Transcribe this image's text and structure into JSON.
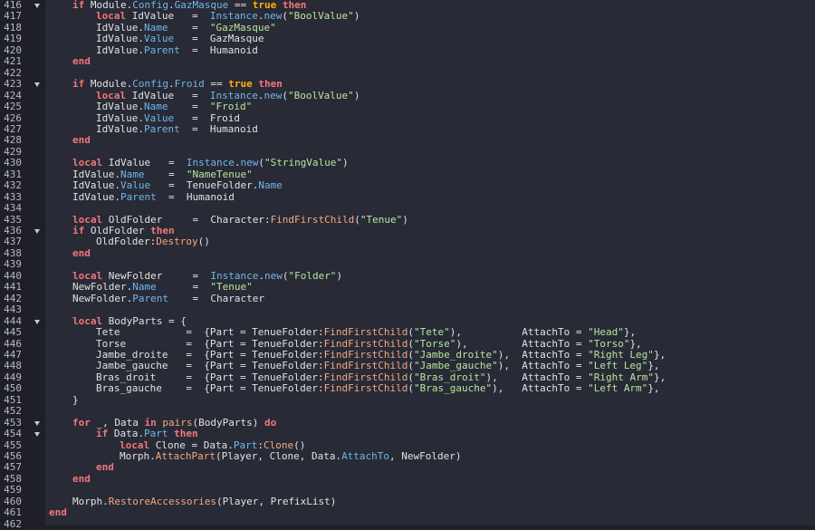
{
  "editor": {
    "lines": [
      {
        "n": "416",
        "fold": true,
        "indent": 1,
        "tokens": [
          [
            "if",
            "k"
          ],
          [
            " Module.",
            "o"
          ],
          [
            "Config",
            "p"
          ],
          [
            ".",
            "o"
          ],
          [
            "GazMasque",
            "p"
          ],
          [
            " == ",
            "o"
          ],
          [
            "true",
            "t"
          ],
          [
            " ",
            "o"
          ],
          [
            "then",
            "k"
          ]
        ]
      },
      {
        "n": "417",
        "fold": false,
        "indent": 2,
        "tokens": [
          [
            "local",
            "k"
          ],
          [
            " IdValue   =  ",
            "o"
          ],
          [
            "Instance",
            "p"
          ],
          [
            ".",
            "o"
          ],
          [
            "new",
            "p"
          ],
          [
            "(",
            "o"
          ],
          [
            "\"BoolValue\"",
            "s"
          ],
          [
            ")",
            "o"
          ]
        ]
      },
      {
        "n": "418",
        "fold": false,
        "indent": 2,
        "tokens": [
          [
            "IdValue.",
            "o"
          ],
          [
            "Name",
            "p"
          ],
          [
            "    =  ",
            "o"
          ],
          [
            "\"GazMasque\"",
            "s"
          ]
        ]
      },
      {
        "n": "419",
        "fold": false,
        "indent": 2,
        "tokens": [
          [
            "IdValue.",
            "o"
          ],
          [
            "Value",
            "p"
          ],
          [
            "   =  GazMasque",
            "o"
          ]
        ]
      },
      {
        "n": "420",
        "fold": false,
        "indent": 2,
        "tokens": [
          [
            "IdValue.",
            "o"
          ],
          [
            "Parent",
            "p"
          ],
          [
            "  =  Humanoid",
            "o"
          ]
        ]
      },
      {
        "n": "421",
        "fold": false,
        "indent": 1,
        "tokens": [
          [
            "end",
            "k"
          ]
        ]
      },
      {
        "n": "422",
        "fold": false,
        "indent": 0,
        "tokens": []
      },
      {
        "n": "423",
        "fold": true,
        "indent": 1,
        "tokens": [
          [
            "if",
            "k"
          ],
          [
            " Module.",
            "o"
          ],
          [
            "Config",
            "p"
          ],
          [
            ".",
            "o"
          ],
          [
            "Froid",
            "p"
          ],
          [
            " == ",
            "o"
          ],
          [
            "true",
            "t"
          ],
          [
            " ",
            "o"
          ],
          [
            "then",
            "k"
          ]
        ]
      },
      {
        "n": "424",
        "fold": false,
        "indent": 2,
        "tokens": [
          [
            "local",
            "k"
          ],
          [
            " IdValue   =  ",
            "o"
          ],
          [
            "Instance",
            "p"
          ],
          [
            ".",
            "o"
          ],
          [
            "new",
            "p"
          ],
          [
            "(",
            "o"
          ],
          [
            "\"BoolValue\"",
            "s"
          ],
          [
            ")",
            "o"
          ]
        ]
      },
      {
        "n": "425",
        "fold": false,
        "indent": 2,
        "tokens": [
          [
            "IdValue.",
            "o"
          ],
          [
            "Name",
            "p"
          ],
          [
            "    =  ",
            "o"
          ],
          [
            "\"Froid\"",
            "s"
          ]
        ]
      },
      {
        "n": "426",
        "fold": false,
        "indent": 2,
        "tokens": [
          [
            "IdValue.",
            "o"
          ],
          [
            "Value",
            "p"
          ],
          [
            "   =  Froid",
            "o"
          ]
        ]
      },
      {
        "n": "427",
        "fold": false,
        "indent": 2,
        "tokens": [
          [
            "IdValue.",
            "o"
          ],
          [
            "Parent",
            "p"
          ],
          [
            "  =  Humanoid",
            "o"
          ]
        ]
      },
      {
        "n": "428",
        "fold": false,
        "indent": 1,
        "tokens": [
          [
            "end",
            "k"
          ]
        ]
      },
      {
        "n": "429",
        "fold": false,
        "indent": 0,
        "tokens": []
      },
      {
        "n": "430",
        "fold": false,
        "indent": 1,
        "tokens": [
          [
            "local",
            "k"
          ],
          [
            " IdValue   =  ",
            "o"
          ],
          [
            "Instance",
            "p"
          ],
          [
            ".",
            "o"
          ],
          [
            "new",
            "p"
          ],
          [
            "(",
            "o"
          ],
          [
            "\"StringValue\"",
            "s"
          ],
          [
            ")",
            "o"
          ]
        ]
      },
      {
        "n": "431",
        "fold": false,
        "indent": 1,
        "tokens": [
          [
            "IdValue.",
            "o"
          ],
          [
            "Name",
            "p"
          ],
          [
            "    =  ",
            "o"
          ],
          [
            "\"NameTenue\"",
            "s"
          ]
        ]
      },
      {
        "n": "432",
        "fold": false,
        "indent": 1,
        "tokens": [
          [
            "IdValue.",
            "o"
          ],
          [
            "Value",
            "p"
          ],
          [
            "   =  TenueFolder.",
            "o"
          ],
          [
            "Name",
            "p"
          ]
        ]
      },
      {
        "n": "433",
        "fold": false,
        "indent": 1,
        "tokens": [
          [
            "IdValue.",
            "o"
          ],
          [
            "Parent",
            "p"
          ],
          [
            "  =  Humanoid",
            "o"
          ]
        ]
      },
      {
        "n": "434",
        "fold": false,
        "indent": 0,
        "tokens": []
      },
      {
        "n": "435",
        "fold": false,
        "indent": 1,
        "tokens": [
          [
            "local",
            "k"
          ],
          [
            " OldFolder     =  Character:",
            "o"
          ],
          [
            "FindFirstChild",
            "f"
          ],
          [
            "(",
            "o"
          ],
          [
            "\"Tenue\"",
            "s"
          ],
          [
            ")",
            "o"
          ]
        ]
      },
      {
        "n": "436",
        "fold": true,
        "indent": 1,
        "tokens": [
          [
            "if",
            "k"
          ],
          [
            " OldFolder ",
            "o"
          ],
          [
            "then",
            "k"
          ]
        ]
      },
      {
        "n": "437",
        "fold": false,
        "indent": 2,
        "tokens": [
          [
            "OldFolder:",
            "o"
          ],
          [
            "Destroy",
            "f"
          ],
          [
            "()",
            "o"
          ]
        ]
      },
      {
        "n": "438",
        "fold": false,
        "indent": 1,
        "tokens": [
          [
            "end",
            "k"
          ]
        ]
      },
      {
        "n": "439",
        "fold": false,
        "indent": 0,
        "tokens": []
      },
      {
        "n": "440",
        "fold": false,
        "indent": 1,
        "tokens": [
          [
            "local",
            "k"
          ],
          [
            " NewFolder     =  ",
            "o"
          ],
          [
            "Instance",
            "p"
          ],
          [
            ".",
            "o"
          ],
          [
            "new",
            "p"
          ],
          [
            "(",
            "o"
          ],
          [
            "\"Folder\"",
            "s"
          ],
          [
            ")",
            "o"
          ]
        ]
      },
      {
        "n": "441",
        "fold": false,
        "indent": 1,
        "tokens": [
          [
            "NewFolder.",
            "o"
          ],
          [
            "Name",
            "p"
          ],
          [
            "      =  ",
            "o"
          ],
          [
            "\"Tenue\"",
            "s"
          ]
        ]
      },
      {
        "n": "442",
        "fold": false,
        "indent": 1,
        "tokens": [
          [
            "NewFolder.",
            "o"
          ],
          [
            "Parent",
            "p"
          ],
          [
            "    =  Character",
            "o"
          ]
        ]
      },
      {
        "n": "443",
        "fold": false,
        "indent": 0,
        "tokens": []
      },
      {
        "n": "444",
        "fold": true,
        "indent": 1,
        "tokens": [
          [
            "local",
            "k"
          ],
          [
            " BodyParts = {",
            "o"
          ]
        ]
      },
      {
        "n": "445",
        "fold": false,
        "indent": 2,
        "tokens": [
          [
            "Tete           =  {Part = TenueFolder:",
            "o"
          ],
          [
            "FindFirstChild",
            "f"
          ],
          [
            "(",
            "o"
          ],
          [
            "\"Tete\"",
            "s"
          ],
          [
            "),          AttachTo = ",
            "o"
          ],
          [
            "\"Head\"",
            "s"
          ],
          [
            "},",
            "o"
          ]
        ]
      },
      {
        "n": "446",
        "fold": false,
        "indent": 2,
        "tokens": [
          [
            "Torse          =  {Part = TenueFolder:",
            "o"
          ],
          [
            "FindFirstChild",
            "f"
          ],
          [
            "(",
            "o"
          ],
          [
            "\"Torse\"",
            "s"
          ],
          [
            "),         AttachTo = ",
            "o"
          ],
          [
            "\"Torso\"",
            "s"
          ],
          [
            "},",
            "o"
          ]
        ]
      },
      {
        "n": "447",
        "fold": false,
        "indent": 2,
        "tokens": [
          [
            "Jambe_droite   =  {Part = TenueFolder:",
            "o"
          ],
          [
            "FindFirstChild",
            "f"
          ],
          [
            "(",
            "o"
          ],
          [
            "\"Jambe_droite\"",
            "s"
          ],
          [
            "),  AttachTo = ",
            "o"
          ],
          [
            "\"Right Leg\"",
            "s"
          ],
          [
            "},",
            "o"
          ]
        ]
      },
      {
        "n": "448",
        "fold": false,
        "indent": 2,
        "tokens": [
          [
            "Jambe_gauche   =  {Part = TenueFolder:",
            "o"
          ],
          [
            "FindFirstChild",
            "f"
          ],
          [
            "(",
            "o"
          ],
          [
            "\"Jambe_gauche\"",
            "s"
          ],
          [
            "),  AttachTo = ",
            "o"
          ],
          [
            "\"Left Leg\"",
            "s"
          ],
          [
            "},",
            "o"
          ]
        ]
      },
      {
        "n": "449",
        "fold": false,
        "indent": 2,
        "tokens": [
          [
            "Bras_droit     =  {Part = TenueFolder:",
            "o"
          ],
          [
            "FindFirstChild",
            "f"
          ],
          [
            "(",
            "o"
          ],
          [
            "\"Bras_droit\"",
            "s"
          ],
          [
            "),    AttachTo = ",
            "o"
          ],
          [
            "\"Right Arm\"",
            "s"
          ],
          [
            "},",
            "o"
          ]
        ]
      },
      {
        "n": "450",
        "fold": false,
        "indent": 2,
        "tokens": [
          [
            "Bras_gauche    =  {Part = TenueFolder:",
            "o"
          ],
          [
            "FindFirstChild",
            "f"
          ],
          [
            "(",
            "o"
          ],
          [
            "\"Bras_gauche\"",
            "s"
          ],
          [
            "),   AttachTo = ",
            "o"
          ],
          [
            "\"Left Arm\"",
            "s"
          ],
          [
            "},",
            "o"
          ]
        ]
      },
      {
        "n": "451",
        "fold": false,
        "indent": 1,
        "tokens": [
          [
            "}",
            "o"
          ]
        ]
      },
      {
        "n": "452",
        "fold": false,
        "indent": 0,
        "tokens": []
      },
      {
        "n": "453",
        "fold": true,
        "indent": 1,
        "tokens": [
          [
            "for",
            "k"
          ],
          [
            " _, Data ",
            "o"
          ],
          [
            "in",
            "k"
          ],
          [
            " ",
            "o"
          ],
          [
            "pairs",
            "f"
          ],
          [
            "(BodyParts) ",
            "o"
          ],
          [
            "do",
            "k"
          ]
        ]
      },
      {
        "n": "454",
        "fold": true,
        "indent": 2,
        "tokens": [
          [
            "if",
            "k"
          ],
          [
            " Data.",
            "o"
          ],
          [
            "Part",
            "p"
          ],
          [
            " ",
            "o"
          ],
          [
            "then",
            "k"
          ]
        ]
      },
      {
        "n": "455",
        "fold": false,
        "indent": 3,
        "tokens": [
          [
            "local",
            "k"
          ],
          [
            " Clone = Data.",
            "o"
          ],
          [
            "Part",
            "p"
          ],
          [
            ":",
            "o"
          ],
          [
            "Clone",
            "f"
          ],
          [
            "()",
            "o"
          ]
        ]
      },
      {
        "n": "456",
        "fold": false,
        "indent": 3,
        "tokens": [
          [
            "Morph.",
            "o"
          ],
          [
            "AttachPart",
            "f"
          ],
          [
            "(Player, Clone, Data.",
            "o"
          ],
          [
            "AttachTo",
            "p"
          ],
          [
            ", NewFolder)",
            "o"
          ]
        ]
      },
      {
        "n": "457",
        "fold": false,
        "indent": 2,
        "tokens": [
          [
            "end",
            "k"
          ]
        ]
      },
      {
        "n": "458",
        "fold": false,
        "indent": 1,
        "tokens": [
          [
            "end",
            "k"
          ]
        ]
      },
      {
        "n": "459",
        "fold": false,
        "indent": 0,
        "tokens": []
      },
      {
        "n": "460",
        "fold": false,
        "indent": 1,
        "tokens": [
          [
            "Morph.",
            "o"
          ],
          [
            "RestoreAccessories",
            "f"
          ],
          [
            "(Player, PrefixList)",
            "o"
          ]
        ]
      },
      {
        "n": "461",
        "fold": false,
        "indent": 0,
        "tokens": [
          [
            "end",
            "k"
          ]
        ]
      },
      {
        "n": "462",
        "fold": false,
        "indent": 0,
        "tokens": []
      }
    ]
  },
  "colors": {
    "keyword": "#f2777a",
    "boolean": "#ffb000",
    "property": "#6fb8e8",
    "function": "#f5a97f",
    "string": "#b9e69a",
    "text": "#e2e2e2",
    "gutter_bg": "#1e1f27",
    "editor_bg": "#282a36"
  },
  "icons": {
    "fold": "chevron-down-icon"
  }
}
